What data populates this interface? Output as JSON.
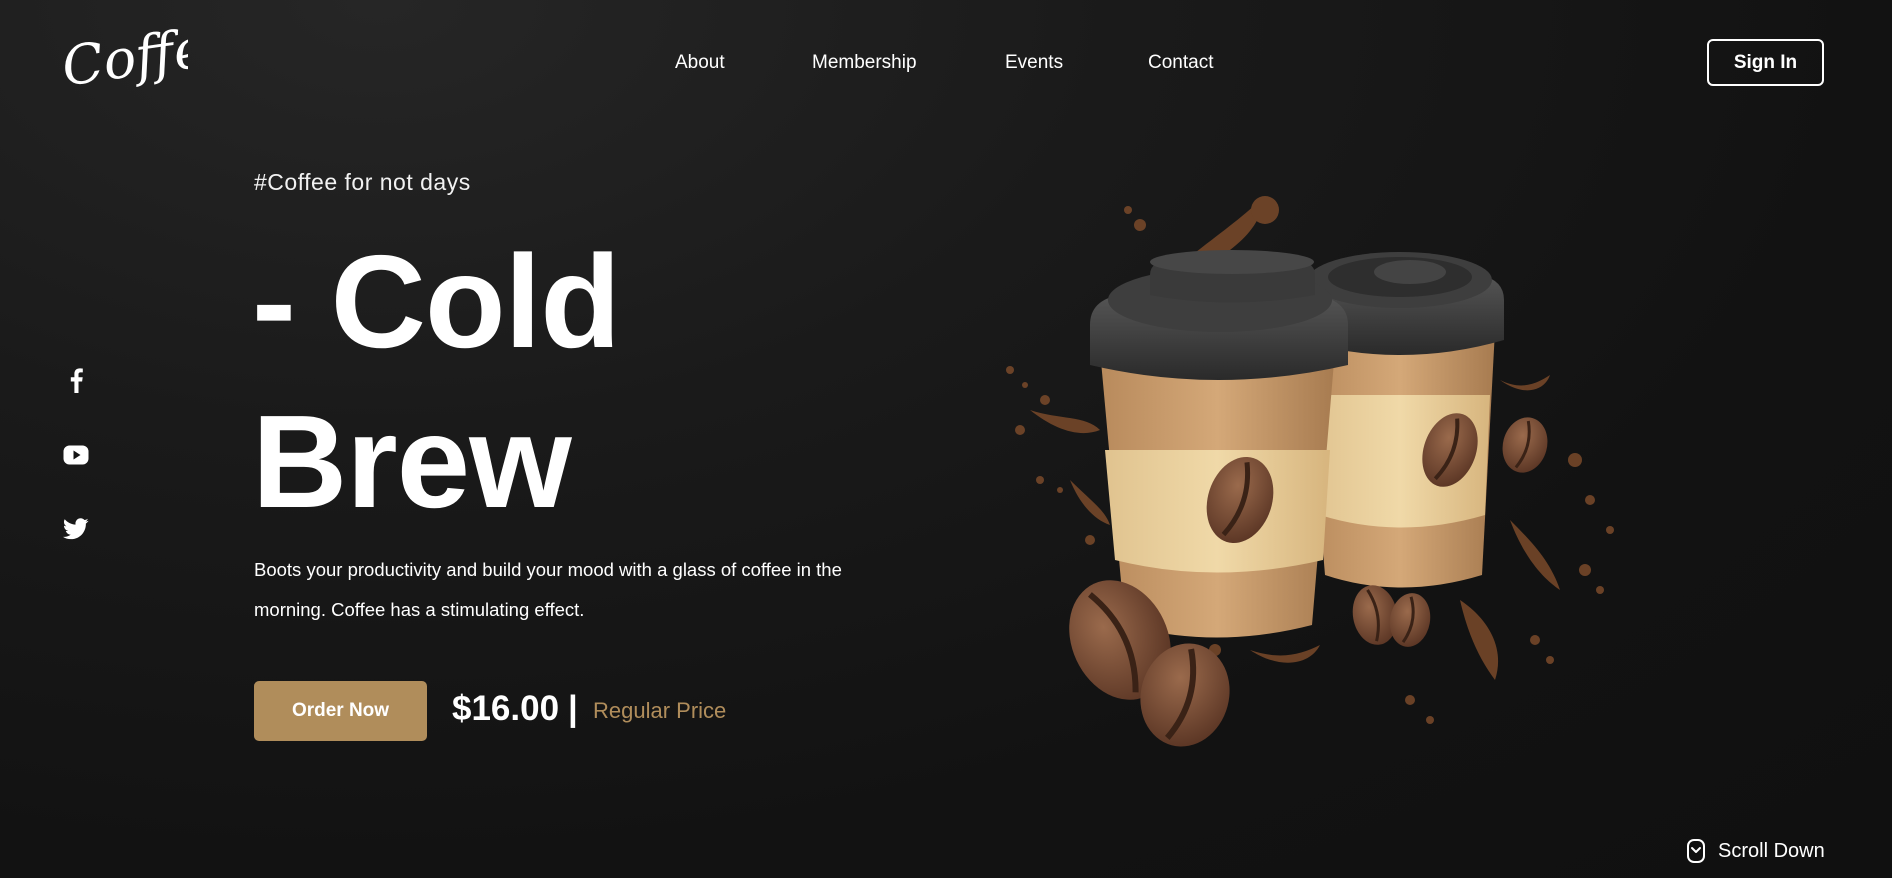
{
  "brand": {
    "logo_text": "Coffee"
  },
  "nav": {
    "items": [
      {
        "label": "About"
      },
      {
        "label": "Membership"
      },
      {
        "label": "Events"
      },
      {
        "label": "Contact"
      }
    ],
    "sign_in_label": "Sign In"
  },
  "social": {
    "icons": [
      "facebook-icon",
      "youtube-icon",
      "twitter-icon"
    ]
  },
  "hero": {
    "tagline": "#Coffee for not days",
    "headline_line1": "- Cold",
    "headline_line2": "Brew",
    "description": "Boots your productivity and build your mood with a glass of coffee in the morning. Coffee has a stimulating effect.",
    "order_button_label": "Order Now",
    "price": "$16.00",
    "price_separator": "|",
    "price_note": "Regular Price",
    "image_subject": "two takeaway coffee cups with coffee beans and splashes"
  },
  "footer": {
    "scroll_label": "Scroll Down"
  },
  "colors": {
    "background": "#141414",
    "accent": "#b08d5b",
    "text": "#ffffff",
    "cup_lid": "#3a3a3a",
    "cup_body": "#c49a6c",
    "cup_sleeve": "#e6cc98",
    "bean": "#6e4530"
  }
}
